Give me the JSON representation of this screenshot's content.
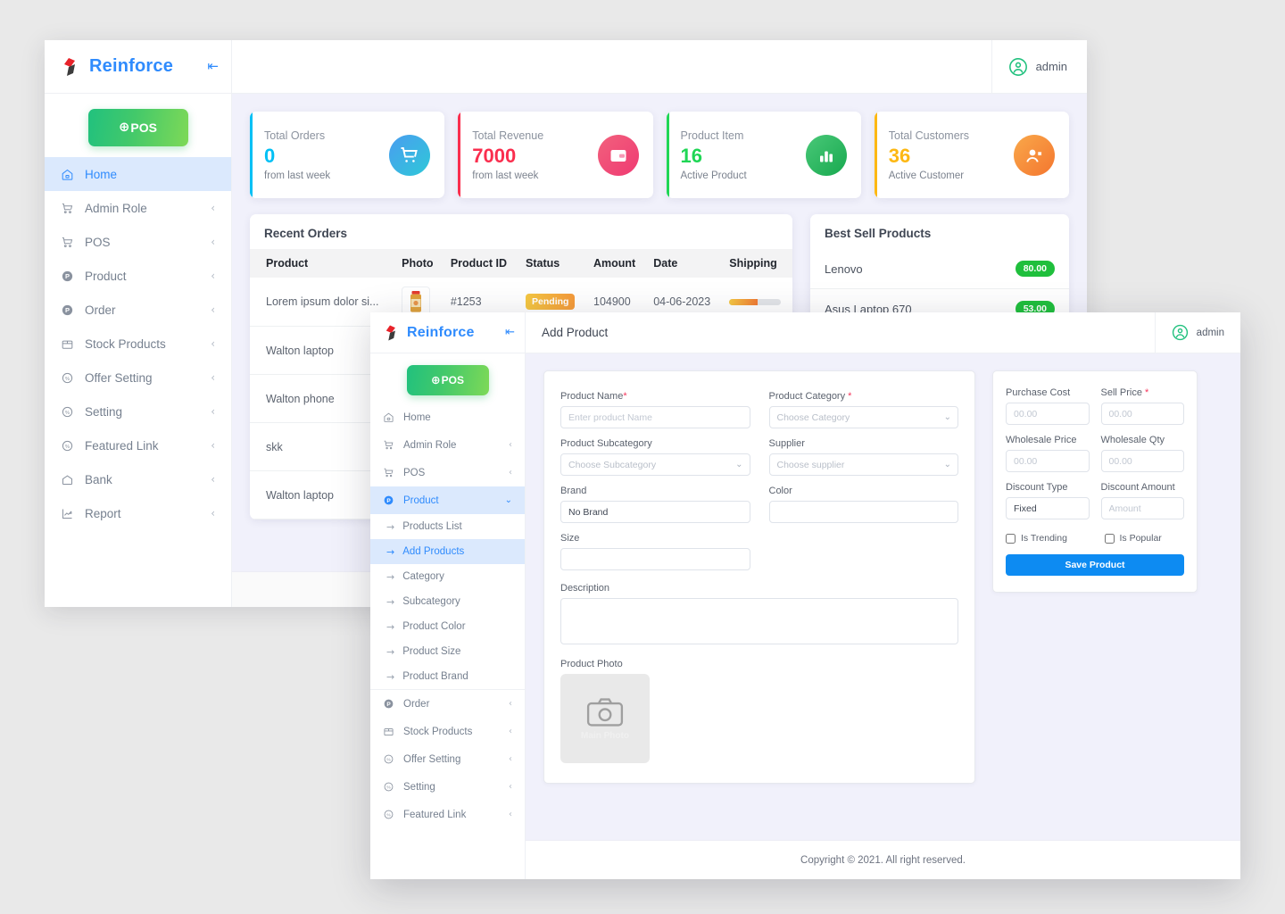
{
  "background_window": {
    "brand": {
      "name": "Reinforce",
      "collapse_icon": "collapse-left-icon"
    },
    "pos_button": {
      "label": "POS"
    },
    "user": {
      "name": "admin",
      "avatar_icon": "user-circle-icon"
    },
    "sidebar_items": [
      {
        "label": "Home",
        "icon": "home-icon",
        "active": true,
        "chevron": false
      },
      {
        "label": "Admin Role",
        "icon": "cart-icon",
        "active": false,
        "chevron": true
      },
      {
        "label": "POS",
        "icon": "cart-icon",
        "active": false,
        "chevron": true
      },
      {
        "label": "Product",
        "icon": "p-circle-icon",
        "active": false,
        "chevron": true
      },
      {
        "label": "Order",
        "icon": "p-circle-icon",
        "active": false,
        "chevron": true
      },
      {
        "label": "Stock Products",
        "icon": "box-icon",
        "active": false,
        "chevron": true
      },
      {
        "label": "Offer Setting",
        "icon": "gear-badge-icon",
        "active": false,
        "chevron": true
      },
      {
        "label": "Setting",
        "icon": "gear-badge-icon",
        "active": false,
        "chevron": true
      },
      {
        "label": "Featured Link",
        "icon": "gear-badge-icon",
        "active": false,
        "chevron": true
      },
      {
        "label": "Bank",
        "icon": "bank-icon",
        "active": false,
        "chevron": true
      },
      {
        "label": "Report",
        "icon": "chart-line-icon",
        "active": false,
        "chevron": true
      }
    ],
    "stats": [
      {
        "label": "Total Orders",
        "value": "0",
        "sub": "from last week",
        "accent": "#00c0f5",
        "grad_from": "#4a9df0",
        "grad_to": "#2ec8d8",
        "icon": "shopping-cart-icon"
      },
      {
        "label": "Total Revenue",
        "value": "7000",
        "sub": "from last week",
        "accent": "#fa2e4e",
        "grad_from": "#f2617d",
        "grad_to": "#ef3a72",
        "icon": "wallet-icon"
      },
      {
        "label": "Product Item",
        "value": "16",
        "sub": "Active Product",
        "accent": "#1fd655",
        "grad_from": "#49c878",
        "grad_to": "#18a94f",
        "icon": "bar-chart-icon"
      },
      {
        "label": "Total Customers",
        "value": "36",
        "sub": "Active Customer",
        "accent": "#fdb813",
        "grad_from": "#f9a84a",
        "grad_to": "#f4762f",
        "icon": "customers-icon"
      }
    ],
    "recent_orders": {
      "title": "Recent Orders",
      "columns": [
        "Product",
        "Photo",
        "Product ID",
        "Status",
        "Amount",
        "Date",
        "Shipping"
      ],
      "rows": [
        {
          "product": "Lorem ipsum dolor si...",
          "photo": "jar-product-photo",
          "product_id": "#1253",
          "status": "Pending",
          "amount": "104900",
          "date": "04-06-2023",
          "shipping_percent": 55
        },
        {
          "product": "Walton laptop",
          "photo": "",
          "product_id": "",
          "status": "",
          "amount": "",
          "date": "",
          "shipping_percent": 0
        },
        {
          "product": "Walton phone",
          "photo": "",
          "product_id": "",
          "status": "",
          "amount": "",
          "date": "",
          "shipping_percent": 0
        },
        {
          "product": "skk",
          "photo": "",
          "product_id": "",
          "status": "",
          "amount": "",
          "date": "",
          "shipping_percent": 0
        },
        {
          "product": "Walton laptop",
          "photo": "",
          "product_id": "",
          "status": "",
          "amount": "",
          "date": "",
          "shipping_percent": 0
        }
      ]
    },
    "best_sell": {
      "title": "Best Sell Products",
      "rows": [
        {
          "name": "Lenovo",
          "price": "80.00"
        },
        {
          "name": "Asus Laptop 670",
          "price": "53.00"
        }
      ]
    }
  },
  "foreground_window": {
    "brand": {
      "name": "Reinforce",
      "collapse_icon": "collapse-left-icon"
    },
    "pos_button": {
      "label": "POS"
    },
    "page_title": "Add Product",
    "user": {
      "name": "admin",
      "avatar_icon": "user-circle-icon"
    },
    "sidebar_items": [
      {
        "label": "Home",
        "icon": "home-icon",
        "active": false,
        "chevron": false
      },
      {
        "label": "Admin Role",
        "icon": "cart-icon",
        "active": false,
        "chevron": true
      },
      {
        "label": "POS",
        "icon": "cart-icon",
        "active": false,
        "chevron": true
      },
      {
        "label": "Product",
        "icon": "p-circle-icon",
        "active": true,
        "chevron": true,
        "expanded": true
      }
    ],
    "sidebar_subitems": [
      {
        "label": "Products List",
        "active": false
      },
      {
        "label": "Add Products",
        "active": true
      },
      {
        "label": "Category",
        "active": false
      },
      {
        "label": "Subcategory",
        "active": false
      },
      {
        "label": "Product Color",
        "active": false
      },
      {
        "label": "Product Size",
        "active": false
      },
      {
        "label": "Product Brand",
        "active": false
      }
    ],
    "sidebar_items_after": [
      {
        "label": "Order",
        "icon": "p-circle-icon",
        "active": false,
        "chevron": true
      },
      {
        "label": "Stock Products",
        "icon": "box-icon",
        "active": false,
        "chevron": true
      },
      {
        "label": "Offer Setting",
        "icon": "gear-badge-icon",
        "active": false,
        "chevron": true
      },
      {
        "label": "Setting",
        "icon": "gear-badge-icon",
        "active": false,
        "chevron": true
      },
      {
        "label": "Featured Link",
        "icon": "gear-badge-icon",
        "active": false,
        "chevron": true
      }
    ],
    "form": {
      "product_name": {
        "label": "Product Name",
        "required": true,
        "placeholder": "Enter product Name",
        "value": ""
      },
      "product_category": {
        "label": "Product Category",
        "required": true,
        "selected": "Choose Category"
      },
      "product_subcategory": {
        "label": "Product Subcategory",
        "required": false,
        "selected": "Choose Subcategory"
      },
      "supplier": {
        "label": "Supplier",
        "required": false,
        "selected": "Choose supplier"
      },
      "brand": {
        "label": "Brand",
        "required": false,
        "value": "No Brand",
        "placeholder": ""
      },
      "color": {
        "label": "Color",
        "required": false,
        "value": "",
        "placeholder": ""
      },
      "size": {
        "label": "Size",
        "required": false,
        "value": "",
        "placeholder": ""
      },
      "description": {
        "label": "Description",
        "required": false,
        "value": "",
        "placeholder": ""
      },
      "product_photo": {
        "label": "Product Photo",
        "box_label": "Main Photo",
        "icon": "camera-icon"
      }
    },
    "pricing": {
      "purchase_cost": {
        "label": "Purchase Cost",
        "required": false,
        "placeholder": "00.00",
        "value": ""
      },
      "sell_price": {
        "label": "Sell Price",
        "required": true,
        "placeholder": "00.00",
        "value": ""
      },
      "wholesale_price": {
        "label": "Wholesale Price",
        "required": false,
        "placeholder": "00.00",
        "value": ""
      },
      "wholesale_qty": {
        "label": "Wholesale Qty",
        "required": false,
        "placeholder": "00.00",
        "value": ""
      },
      "discount_type": {
        "label": "Discount Type",
        "required": false,
        "value": "Fixed"
      },
      "discount_amount": {
        "label": "Discount Amount",
        "required": false,
        "placeholder": "Amount",
        "value": ""
      },
      "is_trending": {
        "label": "Is Trending",
        "checked": false
      },
      "is_popular": {
        "label": "Is Popular",
        "checked": false
      },
      "save_button": {
        "label": "Save Product"
      }
    },
    "footer": {
      "copyright": "Copyright © 2021. All right reserved."
    }
  },
  "colors": {
    "brand_blue": "#2f8bfd",
    "accent_green": "#21c17e",
    "save_blue": "#0d8bf2",
    "required_red": "#f5365c",
    "page_bg": "#f1f1fb",
    "desktop_bg": "#e9e9e9"
  }
}
